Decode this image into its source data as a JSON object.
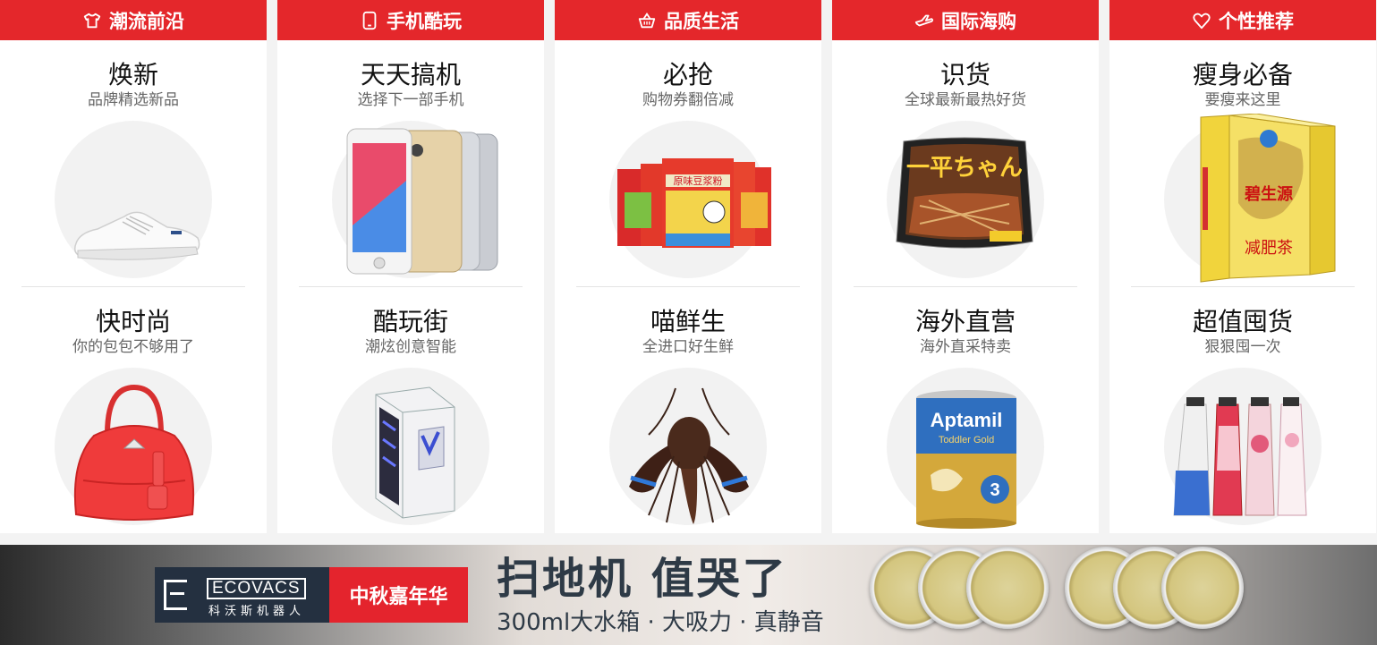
{
  "columns": [
    {
      "header": {
        "label": "潮流前沿",
        "icon": "tshirt-icon"
      },
      "cards": [
        {
          "title": "焕新",
          "subtitle": "品牌精选新品",
          "image": "white-sneaker"
        },
        {
          "title": "快时尚",
          "subtitle": "你的包包不够用了",
          "image": "red-handbag"
        }
      ]
    },
    {
      "header": {
        "label": "手机酷玩",
        "icon": "phone-icon"
      },
      "cards": [
        {
          "title": "天天搞机",
          "subtitle": "选择下一部手机",
          "image": "smartphones"
        },
        {
          "title": "酷玩街",
          "subtitle": "潮炫创意智能",
          "image": "pc-case"
        }
      ]
    },
    {
      "header": {
        "label": "品质生活",
        "icon": "basket-icon"
      },
      "cards": [
        {
          "title": "必抢",
          "subtitle": "购物券翻倍减",
          "image": "soy-milk-powder-bags"
        },
        {
          "title": "喵鲜生",
          "subtitle": "全进口好生鲜",
          "image": "lobster"
        }
      ]
    },
    {
      "header": {
        "label": "国际海购",
        "icon": "plane-icon"
      },
      "cards": [
        {
          "title": "识货",
          "subtitle": "全球最新最热好货",
          "image": "instant-noodle-box"
        },
        {
          "title": "海外直营",
          "subtitle": "海外直采特卖",
          "image": "aptamil-can"
        }
      ]
    },
    {
      "header": {
        "label": "个性推荐",
        "icon": "heart-icon"
      },
      "cards": [
        {
          "title": "瘦身必备",
          "subtitle": "要瘦来这里",
          "image": "slimming-tea-box"
        },
        {
          "title": "超值囤货",
          "subtitle": "狠狠囤一次",
          "image": "hand-cream-tubes"
        }
      ]
    }
  ],
  "product_labels": {
    "aptamil": "Aptamil",
    "toddler": "Toddler Gold",
    "stage": "3",
    "soy": "原味豆浆粉",
    "tea": "碧生源",
    "tea_sub": "减肥茶",
    "noodle": "一平ちゃん"
  },
  "banner": {
    "brand_name": "ECOVACS",
    "brand_cn": "科沃斯机器人",
    "tmall_text": "中秋嘉年华",
    "headline": "扫地机 值哭了",
    "subline": "300ml大水箱 · 大吸力 · 真静音"
  },
  "colors": {
    "header_red": "#e4272b",
    "banner_dark": "#243040",
    "tmall_red": "#e4242d"
  }
}
